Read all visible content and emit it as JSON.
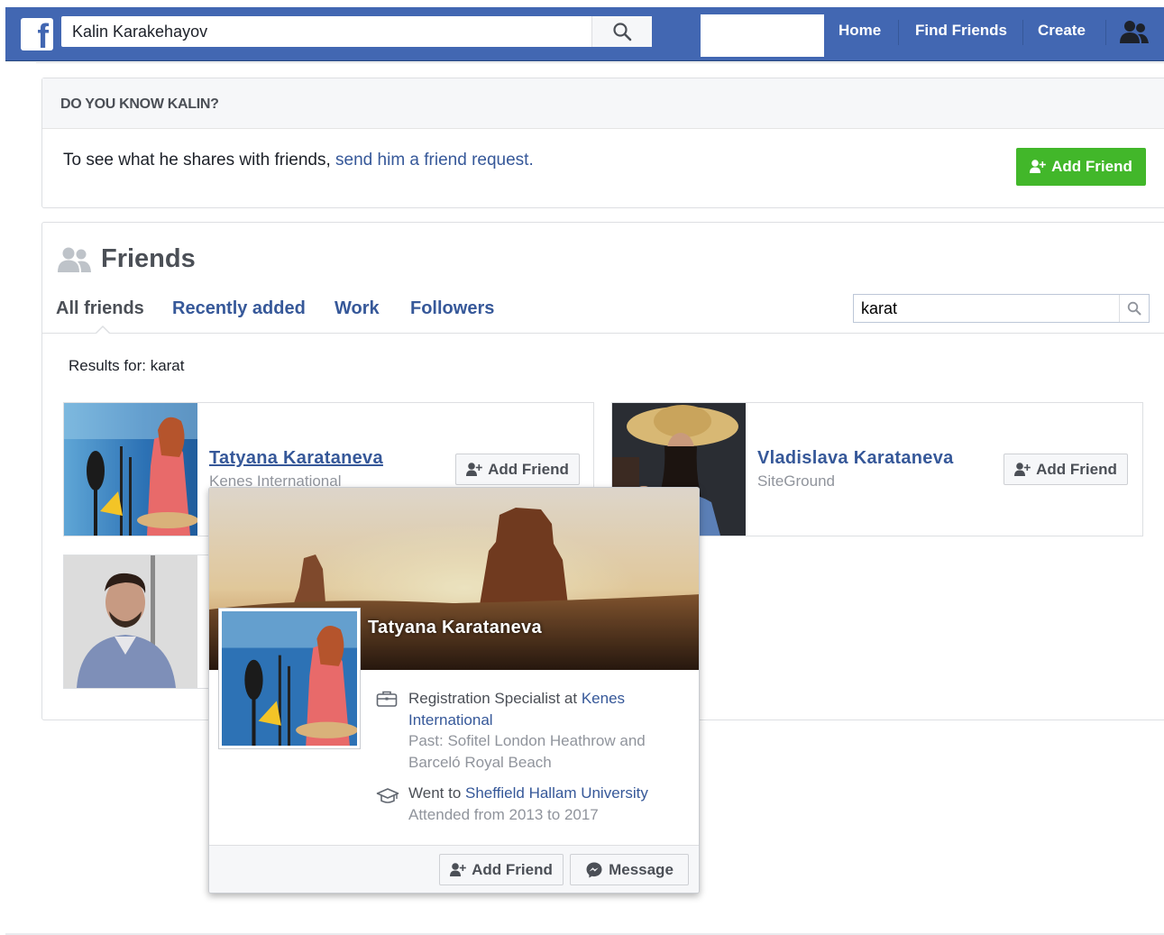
{
  "topbar": {
    "search_value": "Kalin Karakehayov",
    "nav": {
      "home": "Home",
      "find_friends": "Find Friends",
      "create": "Create"
    }
  },
  "know": {
    "header": "DO YOU KNOW KALIN?",
    "text": "To see what he shares with friends, ",
    "link": "send him a friend request.",
    "add_friend": "Add Friend"
  },
  "friends": {
    "title": "Friends",
    "tabs": {
      "all": "All friends",
      "recent": "Recently added",
      "work": "Work",
      "followers": "Followers"
    },
    "search_value": "karat",
    "results_for": "Results for: karat",
    "cards": [
      {
        "name": "Tatyana Karataneva",
        "sub": "Kenes International",
        "button": "Add Friend"
      },
      {
        "name": "Vladislava Karataneva",
        "sub": "SiteGround",
        "button": "Add Friend"
      }
    ]
  },
  "hovercard": {
    "name": "Tatyana Karataneva",
    "work_prefix": "Registration Specialist at ",
    "work_link": "Kenes International",
    "work_past": "Past: Sofitel London Heathrow and Barceló Royal Beach",
    "edu_prefix": "Went to ",
    "edu_link": "Sheffield Hallam University",
    "edu_sub": "Attended from 2013 to 2017",
    "add_friend": "Add Friend",
    "message": "Message"
  },
  "colors": {
    "bar": "#4267b2",
    "link": "#365899",
    "green": "#42b72a"
  }
}
